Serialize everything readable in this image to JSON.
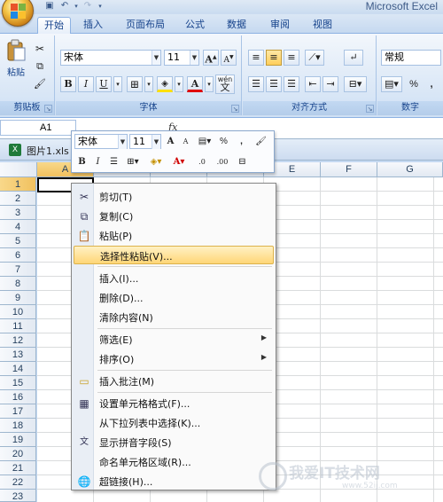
{
  "app": {
    "title": "Microsoft Excel"
  },
  "tabs": [
    "开始",
    "插入",
    "页面布局",
    "公式",
    "数据",
    "审阅",
    "视图"
  ],
  "ribbon": {
    "clipboard": {
      "label": "剪贴板",
      "paste": "粘贴"
    },
    "font": {
      "label": "字体",
      "name": "宋体",
      "size": "11",
      "grow": "A",
      "shrink": "A",
      "bold": "B",
      "italic": "I",
      "underline": "U",
      "phonetic": "wén",
      "phonetic_char": "文"
    },
    "alignment": {
      "label": "对齐方式"
    },
    "number": {
      "label": "数字",
      "format": "常规",
      "percent": "%",
      "comma": ","
    }
  },
  "formula_bar": {
    "name_box": "A1",
    "fx": "fx"
  },
  "workbook": {
    "name": "图片1.xls"
  },
  "columns": [
    "A",
    "B",
    "C",
    "D",
    "E",
    "F",
    "G"
  ],
  "rows": [
    "1",
    "2",
    "3",
    "4",
    "5",
    "6",
    "7",
    "8",
    "9",
    "10",
    "11",
    "12",
    "13",
    "14",
    "15",
    "16",
    "17",
    "18",
    "19",
    "20",
    "21",
    "22",
    "23"
  ],
  "mini_toolbar": {
    "font": "宋体",
    "size": "11",
    "grow": "A",
    "shrink": "A",
    "percent": "%",
    "comma": ",",
    "bold": "B",
    "italic": "I",
    "inc_decimal": ".0",
    "dec_decimal": ".00"
  },
  "context_menu": {
    "items": [
      {
        "label": "剪切(T)",
        "icon": "scissors-icon"
      },
      {
        "label": "复制(C)",
        "icon": "copy-icon"
      },
      {
        "label": "粘贴(P)",
        "icon": "paste-icon"
      },
      {
        "label": "选择性粘贴(V)...",
        "icon": ""
      },
      {
        "label": "插入(I)...",
        "icon": ""
      },
      {
        "label": "删除(D)...",
        "icon": ""
      },
      {
        "label": "清除内容(N)",
        "icon": ""
      },
      {
        "label": "筛选(E)",
        "icon": "",
        "submenu": true
      },
      {
        "label": "排序(O)",
        "icon": "",
        "submenu": true
      },
      {
        "label": "插入批注(M)",
        "icon": "comment-icon"
      },
      {
        "label": "设置单元格格式(F)...",
        "icon": "format-cells-icon"
      },
      {
        "label": "从下拉列表中选择(K)...",
        "icon": ""
      },
      {
        "label": "显示拼音字段(S)",
        "icon": "phonetic-icon"
      },
      {
        "label": "命名单元格区域(R)...",
        "icon": ""
      },
      {
        "label": "超链接(H)...",
        "icon": "hyperlink-icon"
      }
    ]
  },
  "watermark": {
    "text": "我爱IT技术网",
    "url": "www.52ij.com"
  },
  "colors": {
    "accent": "#15428b",
    "highlight": "#ffd677",
    "selected_header": "#f1c15f"
  }
}
